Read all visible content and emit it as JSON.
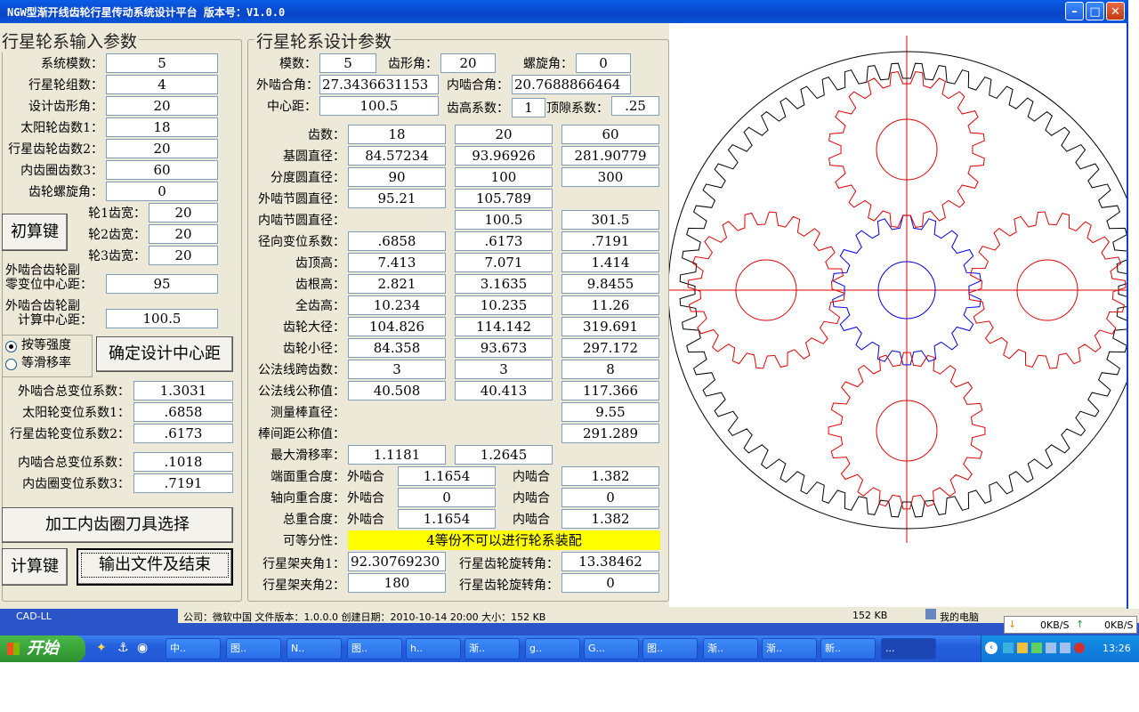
{
  "window": {
    "title": "NGW型渐开线齿轮行星传动系统设计平台   版本号：V1.0.0"
  },
  "input_group": {
    "title": "行星轮系输入参数",
    "system_module_label": "系统模数：",
    "system_module": "5",
    "planet_groups_label": "行星轮组数：",
    "planet_groups": "4",
    "pressure_angle_label": "设计齿形角：",
    "pressure_angle": "20",
    "sun_teeth_label": "太阳轮齿数1：",
    "sun_teeth": "18",
    "planet_teeth_label": "行星齿轮齿数2：",
    "planet_teeth": "20",
    "ring_teeth_label": "内齿圈齿数3：",
    "ring_teeth": "60",
    "helix_angle_label": "齿轮螺旋角：",
    "helix_angle": "0",
    "width1_label": "轮1齿宽：",
    "width1": "20",
    "width2_label": "轮2齿宽：",
    "width2": "20",
    "width3_label": "轮3齿宽：",
    "width3": "20",
    "initial_calc_button": "初算键",
    "zero_shift_label_1": "外啮合齿轮副",
    "zero_shift_label_2": "零变位中心距：",
    "zero_shift_center": "95",
    "calc_center_label_1": "外啮合齿轮副",
    "calc_center_label_2": "计算中心距：",
    "calc_center": "100.5",
    "radio_equal_strength": "按等强度",
    "radio_equal_slip": "等滑移率",
    "confirm_center_button": "确定设计中心距",
    "ext_total_shift_label": "外啮合总变位系数：",
    "ext_total_shift": "1.3031",
    "sun_shift_label": "太阳轮变位系数1：",
    "sun_shift": ".6858",
    "planet_shift_label": "行星齿轮变位系数2：",
    "planet_shift": ".6173",
    "int_total_shift_label": "内啮合总变位系数：",
    "int_total_shift": ".1018",
    "ring_shift_label": "内齿圈变位系数3：",
    "ring_shift": ".7191",
    "tool_select_button": "加工内齿圈刀具选择",
    "calc_button": "计算键",
    "output_button": "输出文件及结束"
  },
  "design_group": {
    "title": "行星轮系设计参数",
    "module_label": "模数：",
    "module": "5",
    "tooth_angle_label": "齿形角：",
    "tooth_angle": "20",
    "helix_label": "螺旋角：",
    "helix": "0",
    "ext_mesh_angle_label": "外啮合角：",
    "ext_mesh_angle": "27.3436631153",
    "int_mesh_angle_label": "内啮合角：",
    "int_mesh_angle": "20.7688866464",
    "center_distance_label": "中心距：",
    "center_distance": "100.5",
    "addendum_coef_label": "齿高系数：",
    "addendum_coef": "1",
    "clearance_coef_label": "顶隙系数：",
    "clearance_coef": ".25",
    "rows": [
      {
        "label": "齿数：",
        "values": [
          "18",
          "20",
          "60"
        ]
      },
      {
        "label": "基圆直径：",
        "values": [
          "84.57234",
          "93.96926",
          "281.90779"
        ]
      },
      {
        "label": "分度圆直径：",
        "values": [
          "90",
          "100",
          "300"
        ]
      },
      {
        "label": "外啮节圆直径：",
        "values": [
          "95.21",
          "105.789",
          ""
        ]
      },
      {
        "label": "内啮节圆直径：",
        "values": [
          "",
          "100.5",
          "301.5"
        ]
      },
      {
        "label": "径向变位系数：",
        "values": [
          ".6858",
          ".6173",
          ".7191"
        ]
      },
      {
        "label": "齿顶高：",
        "values": [
          "7.413",
          "7.071",
          "1.414"
        ]
      },
      {
        "label": "齿根高：",
        "values": [
          "2.821",
          "3.1635",
          "9.8455"
        ]
      },
      {
        "label": "全齿高：",
        "values": [
          "10.234",
          "10.235",
          "11.26"
        ]
      },
      {
        "label": "齿轮大径：",
        "values": [
          "104.826",
          "114.142",
          "319.691"
        ]
      },
      {
        "label": "齿轮小径：",
        "values": [
          "84.358",
          "93.673",
          "297.172"
        ]
      },
      {
        "label": "公法线跨齿数：",
        "values": [
          "3",
          "3",
          "8"
        ]
      },
      {
        "label": "公法线公称值：",
        "values": [
          "40.508",
          "40.413",
          "117.366"
        ]
      },
      {
        "label": "测量棒直径：",
        "values": [
          "",
          "",
          "9.55"
        ]
      },
      {
        "label": "棒间距公称值：",
        "values": [
          "",
          "",
          "291.289"
        ]
      },
      {
        "label": "最大滑移率：",
        "values": [
          "1.1181",
          "1.2645",
          ""
        ]
      }
    ],
    "contact_rows": [
      {
        "label": "端面重合度：",
        "ext_label": "外啮合",
        "ext": "1.1654",
        "int_label": "内啮合",
        "int": "1.382"
      },
      {
        "label": "轴向重合度：",
        "ext_label": "外啮合",
        "ext": "0",
        "int_label": "内啮合",
        "int": "0"
      },
      {
        "label": "总重合度：",
        "ext_label": "外啮合",
        "ext": "1.1654",
        "int_label": "内啮合",
        "int": "1.382"
      }
    ],
    "divisibility_label": "可等分性：",
    "divisibility_value": "4等份不可以进行轮系装配",
    "carrier_angle1_label": "行星架夹角1：",
    "carrier_angle1": "92.30769230",
    "planet_rot1_label": "行星齿轮旋转角：",
    "planet_rot1": "13.38462",
    "carrier_angle2_label": "行星架夹角2：",
    "carrier_angle2": "180",
    "planet_rot2_label": "行星齿轮旋转角：",
    "planet_rot2": "0"
  },
  "gear_drawing": {
    "ring_teeth": 60,
    "planet_teeth": 20,
    "sun_teeth": 18,
    "planets": 4,
    "planet_color": "#e00000",
    "sun_color": "#0000e0",
    "ring_color": "#000000",
    "axis_color": "#e00000"
  },
  "statusbar": {
    "app_label": "CAD-LL",
    "info": "公司：微软中国  文件版本：1.0.0.0  创建日期：2010-10-14 20:00  大小：152 KB",
    "size": "152 KB",
    "location": "我的电脑"
  },
  "net_popup": {
    "down": "0KB/S",
    "up": "0KB/S"
  },
  "taskbar": {
    "start": "开始",
    "tasks": [
      "中..",
      "图..",
      "N..",
      "图..",
      "h..",
      "渐..",
      "g..",
      "G...",
      "图..",
      "渐..",
      "渐..",
      "新..",
      "..."
    ],
    "clock": "13:26"
  }
}
